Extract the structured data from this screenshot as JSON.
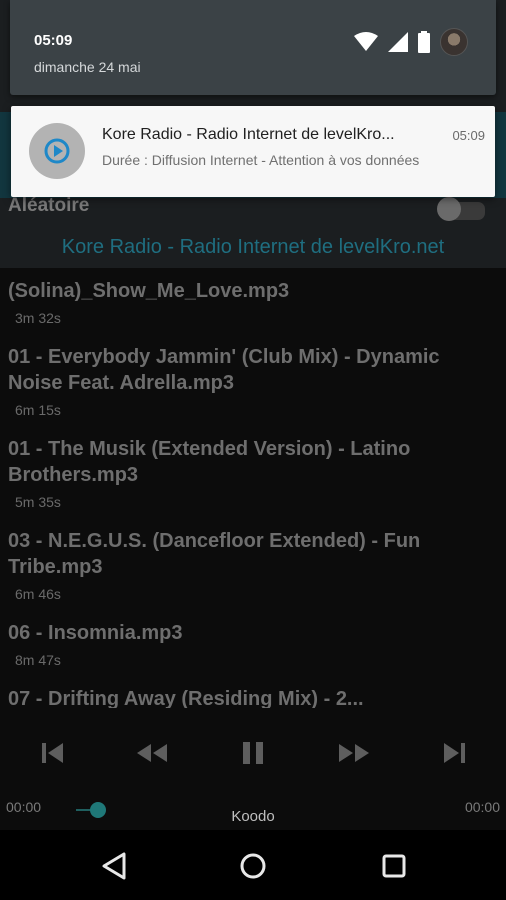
{
  "status": {
    "time": "05:09",
    "date": "dimanche 24 mai"
  },
  "notification": {
    "title": "Kore Radio - Radio Internet de levelKro...",
    "time": "05:09",
    "text": "Durée : Diffusion Internet - Attention à vos données",
    "icon": "play-circle-icon"
  },
  "app": {
    "shuffle_label": "Aléatoire",
    "shuffle_on": false,
    "station_title": "Kore Radio - Radio Internet de levelKro.net",
    "tracks": [
      {
        "title": "(Solina)_Show_Me_Love.mp3",
        "duration": "3m 32s"
      },
      {
        "title": "01 - Everybody Jammin' (Club Mix) - Dynamic Noise Feat. Adrella.mp3",
        "duration": "6m 15s"
      },
      {
        "title": "01 - The Musik (Extended Version) - Latino Brothers.mp3",
        "duration": "5m 35s"
      },
      {
        "title": "03 - N.E.G.U.S. (Dancefloor Extended) - Fun Tribe.mp3",
        "duration": "6m 46s"
      },
      {
        "title": "06 - Insomnia.mp3",
        "duration": "8m 47s"
      },
      {
        "title": "07 - Drifting Away (Residing Mix) - 2...",
        "duration": ""
      }
    ],
    "time_elapsed": "00:00",
    "time_total": "00:00",
    "carrier": "Koodo"
  },
  "colors": {
    "accent": "#1f7878",
    "notification_bg": "#f7f7f7",
    "shade_bg": "#3b4246"
  }
}
